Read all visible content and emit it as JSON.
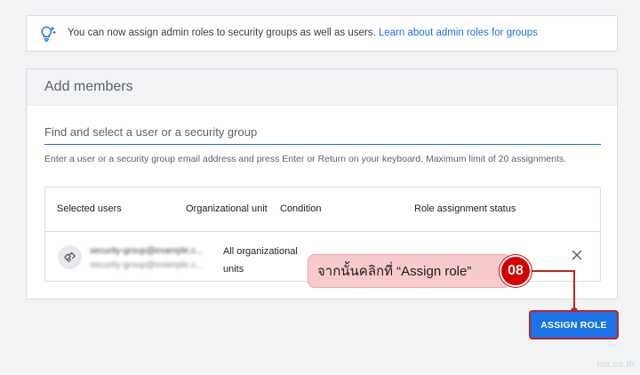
{
  "banner": {
    "icon": "lightbulb-icon",
    "text": "You can now assign admin roles to security groups as well as users. ",
    "link": "Learn about admin roles for groups"
  },
  "add_members": {
    "title": "Add members",
    "search_placeholder": "Find and select a user or a security group",
    "hint": "Enter a user or a security group email address and press Enter or Return on your keyboard. Maximum limit of 20 assignments."
  },
  "table": {
    "columns": [
      "Selected users",
      "Organizational unit",
      "Condition",
      "Role assignment status"
    ],
    "rows": [
      {
        "name": "security-group@example.c...",
        "email": "security-group@example.c...",
        "org_unit": "All organizational units",
        "avatar_icon": "group-icon"
      }
    ]
  },
  "assign_button": {
    "label": "ASSIGN ROLE"
  },
  "annotation": {
    "text": "จากนั้นคลิกที่ “Assign role”",
    "step": "08"
  },
  "watermark": "nts.co.th",
  "colors": {
    "accent": "#1a73e8",
    "annotation": "#d50000",
    "callout_bg": "#f8c9cd"
  }
}
